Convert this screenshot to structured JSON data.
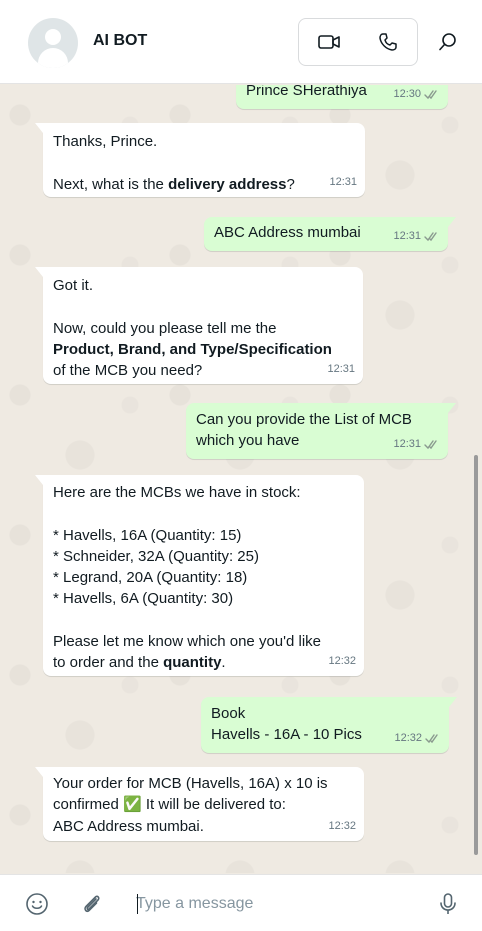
{
  "header": {
    "contact_name": "AI BOT",
    "icons": [
      "avatar",
      "video-call-icon",
      "voice-call-icon",
      "search-icon"
    ]
  },
  "messages": [
    {
      "dir": "out",
      "lines": [
        "Prince SHerathiya"
      ],
      "time": "12:30",
      "read": true
    },
    {
      "dir": "in",
      "lines": [
        "Thanks, Prince.",
        "",
        "Next, what is the |delivery address|?"
      ],
      "time": "12:31"
    },
    {
      "dir": "out",
      "lines": [
        "ABC Address mumbai"
      ],
      "time": "12:31",
      "read": true
    },
    {
      "dir": "in",
      "lines": [
        "Got it.",
        "",
        "Now, could you please tell me the",
        "|Product, Brand, and Type/Specification|",
        "of the MCB you need?"
      ],
      "time": "12:31"
    },
    {
      "dir": "out",
      "lines": [
        "Can you provide the List of MCB",
        "which you have"
      ],
      "time": "12:31",
      "read": true
    },
    {
      "dir": "in",
      "lines": [
        "Here are the MCBs we have in stock:",
        "",
        "* Havells, 16A (Quantity: 15)",
        "* Schneider, 32A (Quantity: 25)",
        "* Legrand, 20A (Quantity: 18)",
        "* Havells, 6A (Quantity: 30)",
        "",
        "Please let me know which one you'd like",
        "to order and the |quantity|."
      ],
      "time": "12:32"
    },
    {
      "dir": "out",
      "lines": [
        "Book",
        "Havells - 16A - 10 Pics"
      ],
      "time": "12:32",
      "read": true
    },
    {
      "dir": "in",
      "lines": [
        "Your order for MCB (Havells, 16A) x 10 is",
        "confirmed ✅ It will be delivered to:",
        "ABC Address mumbai."
      ],
      "time": "12:32"
    }
  ],
  "composer": {
    "placeholder": "Type a message",
    "icons": [
      "emoji-icon",
      "attach-icon",
      "mic-icon"
    ]
  },
  "colors": {
    "incoming": "#ffffff",
    "outgoing": "#d9fdd3",
    "read_ticks": "#53bdeb",
    "background": "#efeae2"
  }
}
